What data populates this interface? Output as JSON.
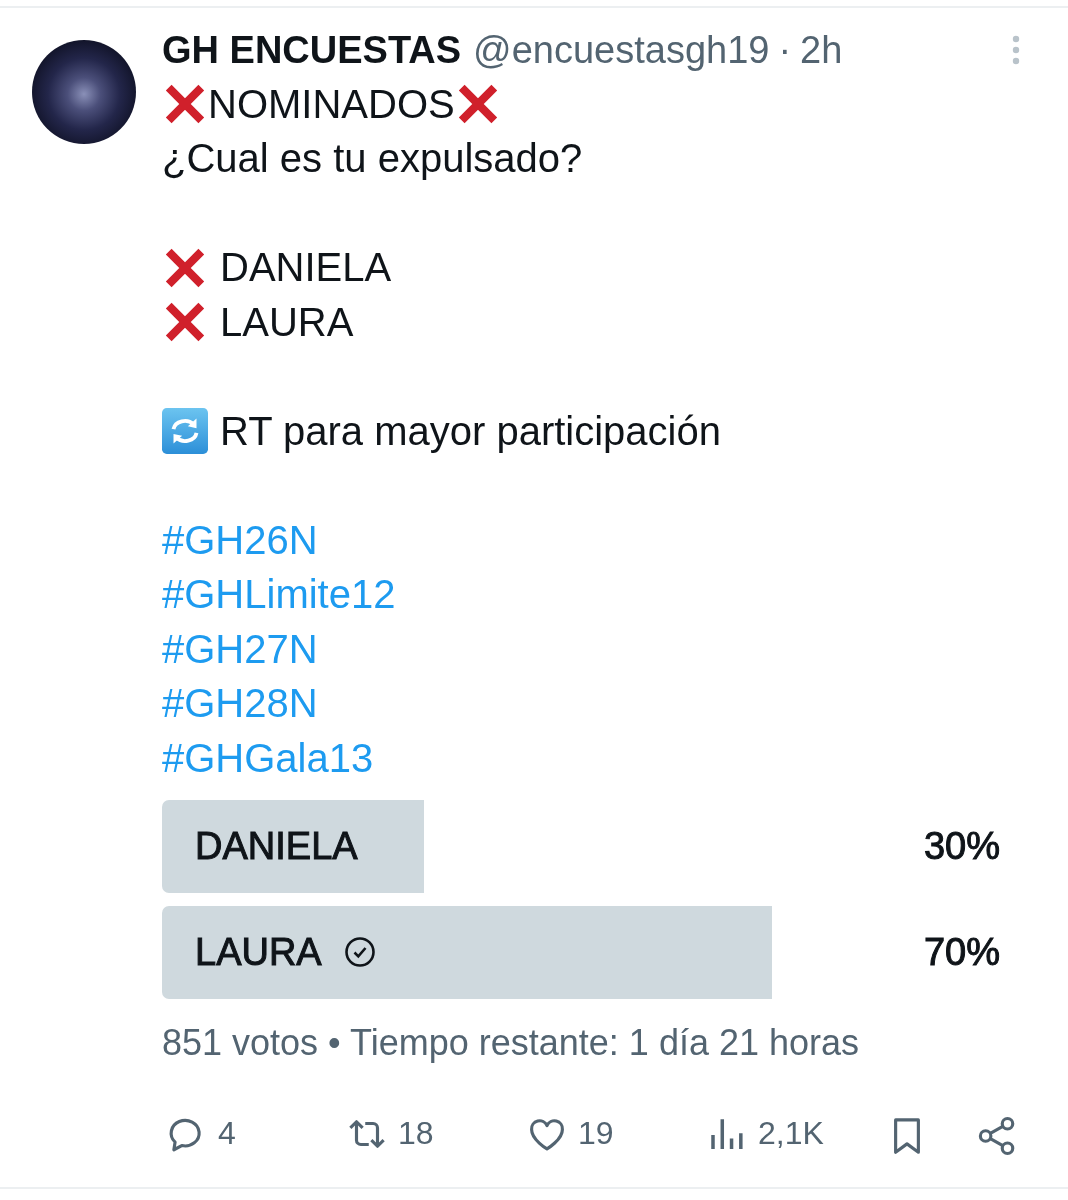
{
  "post": {
    "author": {
      "name": "GH ENCUESTAS",
      "handle": "@encuestasgh19",
      "separator": "·",
      "time": "2h"
    },
    "paragraphs": [
      [
        {
          "kind": "framed",
          "text": "NOMINADOS"
        },
        {
          "kind": "plain",
          "text": "¿Cual es tu expulsado?"
        }
      ],
      [
        {
          "kind": "crossed",
          "text": "DANIELA"
        },
        {
          "kind": "crossed",
          "text": "LAURA"
        }
      ],
      [
        {
          "kind": "retweet",
          "text": "RT para mayor participación"
        }
      ],
      [
        {
          "kind": "hashtag",
          "text": "#GH26N"
        },
        {
          "kind": "hashtag",
          "text": "#GHLimite12"
        },
        {
          "kind": "hashtag",
          "text": "#GH27N"
        },
        {
          "kind": "hashtag",
          "text": "#GH28N"
        },
        {
          "kind": "hashtag",
          "text": "#GHGala13"
        }
      ]
    ],
    "poll": {
      "options": [
        {
          "label": "DANIELA",
          "percent": "30%",
          "level": 0.3,
          "voted": false
        },
        {
          "label": "LAURA",
          "percent": "70%",
          "level": 0.7,
          "voted": true
        }
      ],
      "summary": "851 votos • Tiempo restante: 1 día 21 horas"
    },
    "actions": [
      {
        "kind": "reply",
        "count": "4"
      },
      {
        "kind": "repost",
        "count": "18"
      },
      {
        "kind": "like",
        "count": "19"
      },
      {
        "kind": "views",
        "count": "2,1K"
      },
      {
        "kind": "bookmark"
      },
      {
        "kind": "share"
      }
    ]
  }
}
